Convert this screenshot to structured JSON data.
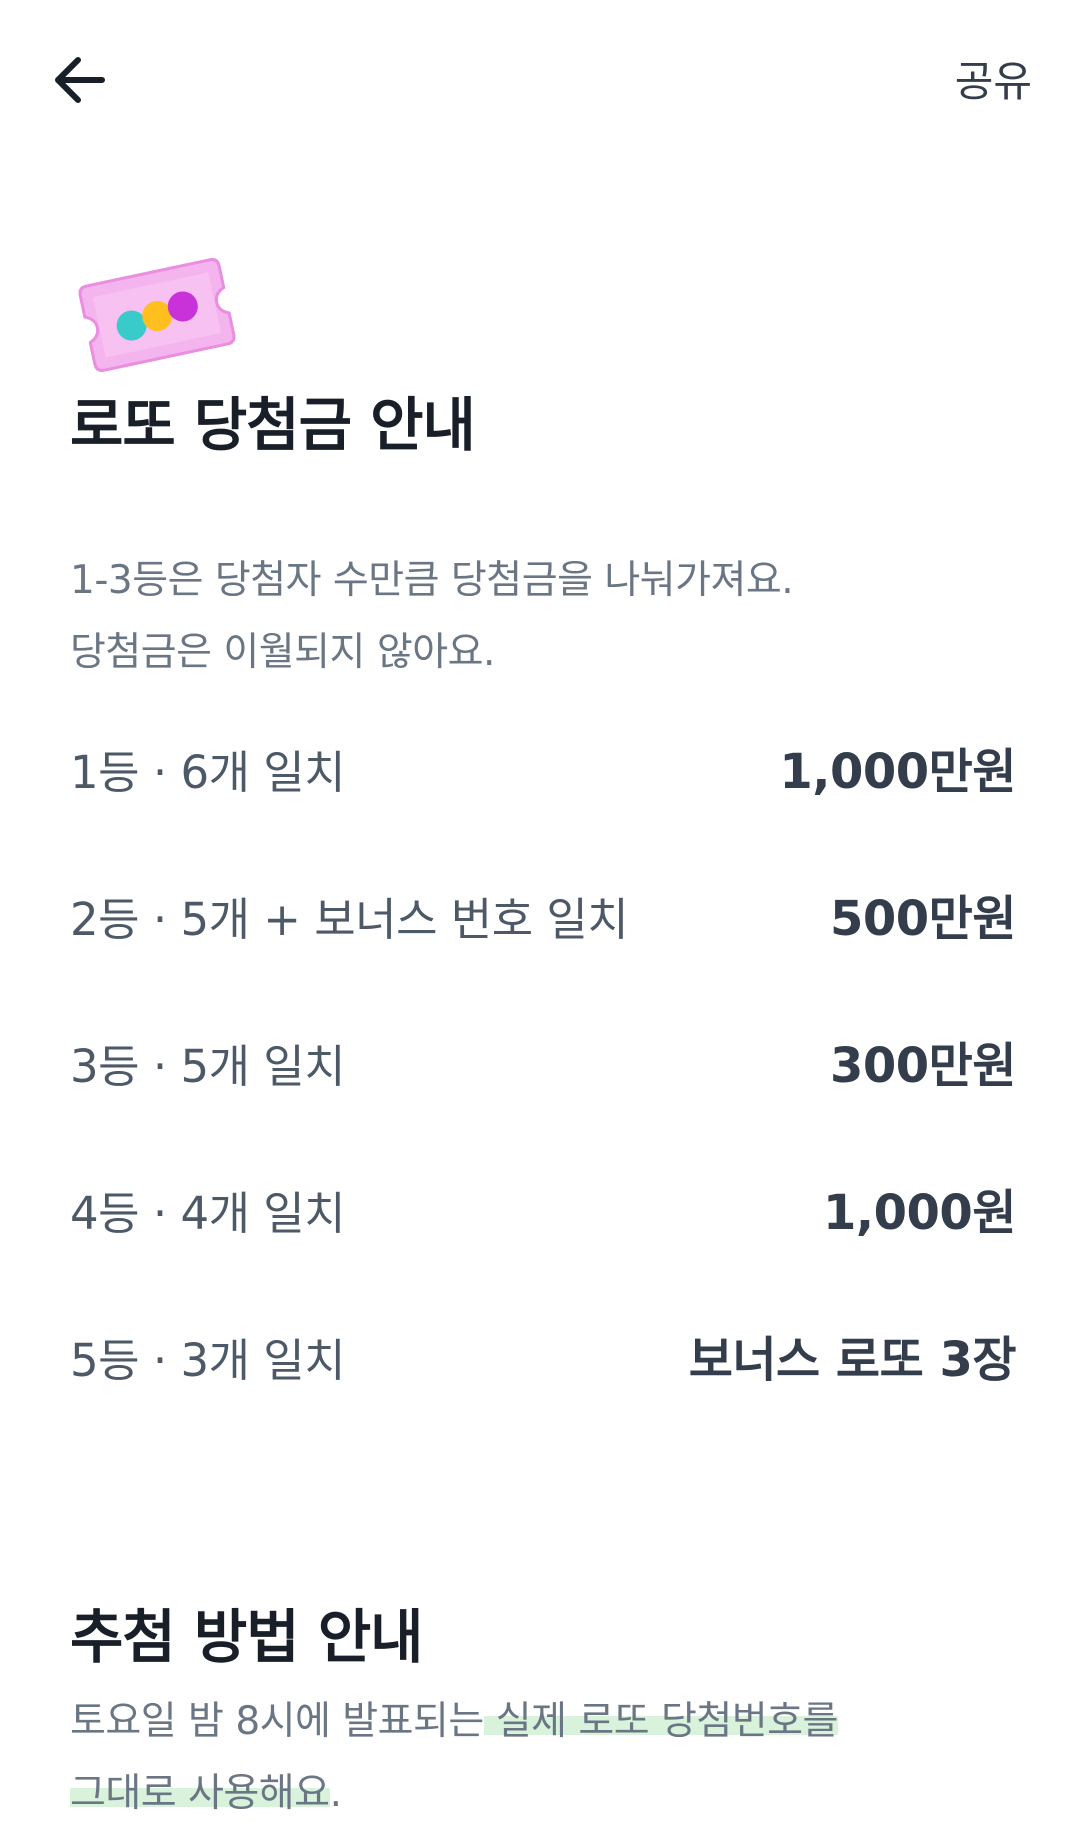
{
  "header": {
    "back_icon": "arrow-left-icon",
    "share_label": "공유"
  },
  "prize_section": {
    "title": "로또 당첨금 안내",
    "desc_line1": "1-3등은 당첨자 수만큼 당첨금을 나눠가져요.",
    "desc_line2": "당첨금은 이월되지 않아요.",
    "rows": [
      {
        "label": "1등 · 6개 일치",
        "amount": "1,000만원"
      },
      {
        "label": "2등 · 5개 + 보너스 번호 일치",
        "amount": "500만원"
      },
      {
        "label": "3등 · 5개 일치",
        "amount": "300만원"
      },
      {
        "label": "4등 · 4개 일치",
        "amount": "1,000원"
      },
      {
        "label": "5등 · 3개 일치",
        "amount": "보너스 로또 3장"
      }
    ]
  },
  "draw_section": {
    "title": "추첨 방법 안내",
    "desc_part1": "토요일 밤 8시에 발표되는",
    "desc_part2": " 실제 로또 당첨번호를",
    "desc_part3": "그대로 사용해요",
    "desc_part4": "."
  },
  "colors": {
    "title": "#191f28",
    "body": "#6b7684",
    "highlight": "#d9f2dc",
    "ticket": "#f0a3ea"
  }
}
